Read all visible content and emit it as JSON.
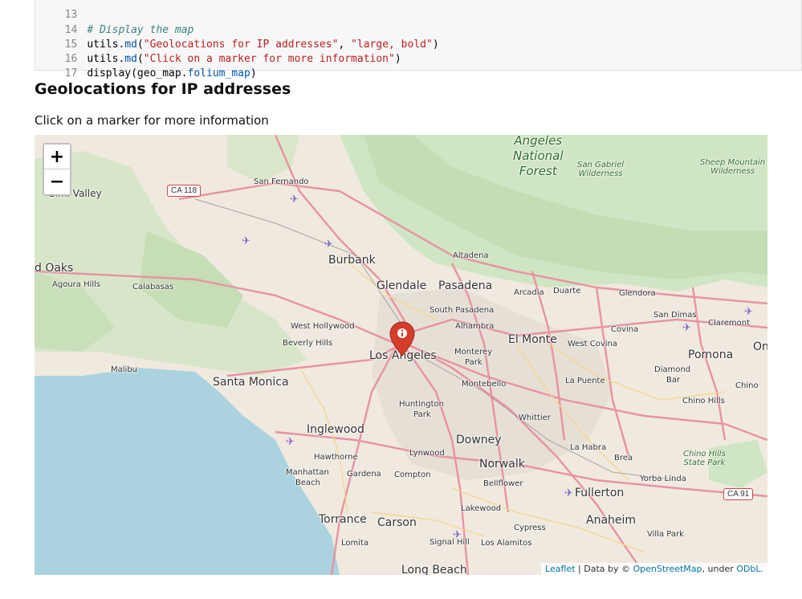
{
  "code": {
    "lines": [
      {
        "num": "13"
      },
      {
        "num": "14",
        "comment": "# Display the map"
      },
      {
        "num": "15",
        "obj": "utils.",
        "fn": "md",
        "open": "(",
        "arg1": "\"Geolocations for IP addresses\"",
        "sep": ", ",
        "arg2": "\"large, bold\"",
        "close": ")"
      },
      {
        "num": "16",
        "obj": "utils.",
        "fn": "md",
        "open": "(",
        "arg1": "\"Click on a marker for more information\"",
        "close": ")"
      },
      {
        "num": "17",
        "obj": "display(geo_map.",
        "fn": "folium_map",
        "close": ")"
      }
    ]
  },
  "output": {
    "title": "Geolocations for IP addresses",
    "subtitle": "Click on a marker for more information"
  },
  "map": {
    "zoom_in": "+",
    "zoom_out": "−",
    "marker_icon": "info-icon",
    "attribution": {
      "leaflet": "Leaflet",
      "sep1": " | Data by © ",
      "osm": "OpenStreetMap",
      "sep2": ", under ",
      "odbl": "ODbL."
    },
    "shields": {
      "ca118": "CA 118",
      "ca91": "CA 91"
    },
    "labels": {
      "simi_valley": "Simi Valley",
      "thousand_oaks": "d Oaks",
      "agoura_hills": "Agoura Hills",
      "calabasas": "Calabasas",
      "san_fernando": "San Fernando",
      "burbank": "Burbank",
      "altadena": "Altadena",
      "glendale": "Glendale",
      "pasadena": "Pasadena",
      "arcadia": "Arcadia",
      "duarte": "Duarte",
      "glendora": "Glendora",
      "south_pasadena": "South Pasadena",
      "alhambra": "Alhambra",
      "west_hollywood": "West Hollywood",
      "beverly_hills": "Beverly Hills",
      "los_angeles": "Los Angeles",
      "monterey_park_1": "Monterey",
      "monterey_park_2": "Park",
      "el_monte": "El Monte",
      "west_covina": "West Covina",
      "covina": "Covina",
      "san_dimas": "San Dimas",
      "claremont": "Claremont",
      "pomona": "Pomona",
      "on": "On",
      "malibu": "Malibu",
      "santa_monica": "Santa Monica",
      "montebello": "Montebello",
      "la_puente": "La Puente",
      "diamond_bar_1": "Diamond",
      "diamond_bar_2": "Bar",
      "chino": "Chino",
      "chino_hills": "Chino Hills",
      "huntington_park_1": "Huntington",
      "huntington_park_2": "Park",
      "whittier": "Whittier",
      "inglewood": "Inglewood",
      "downey": "Downey",
      "la_habra": "La Habra",
      "brea": "Brea",
      "hawthorne": "Hawthorne",
      "lynwood": "Lynwood",
      "norwalk": "Norwalk",
      "manhattan_beach_1": "Manhattan",
      "manhattan_beach_2": "Beach",
      "gardena": "Gardena",
      "compton": "Compton",
      "bellflower": "Bellflower",
      "fullerton": "Fullerton",
      "yorba_linda": "Yorba Linda",
      "lakewood": "Lakewood",
      "torrance": "Torrance",
      "carson": "Carson",
      "cypress": "Cypress",
      "anaheim": "Anaheim",
      "villa_park": "Villa Park",
      "lomita": "Lomita",
      "signal_hill": "Signal Hill",
      "los_alamitos": "Los Alamitos",
      "long_beach": "Long Beach"
    },
    "green_labels": {
      "anf_1": "Angeles",
      "anf_2": "National",
      "anf_3": "Forest",
      "sgw_1": "San Gabriel",
      "sgw_2": "Wilderness",
      "smw_1": "Sheep Mountain",
      "smw_2": "Wilderness",
      "chsp_1": "Chino Hills",
      "chsp_2": "State Park"
    }
  }
}
